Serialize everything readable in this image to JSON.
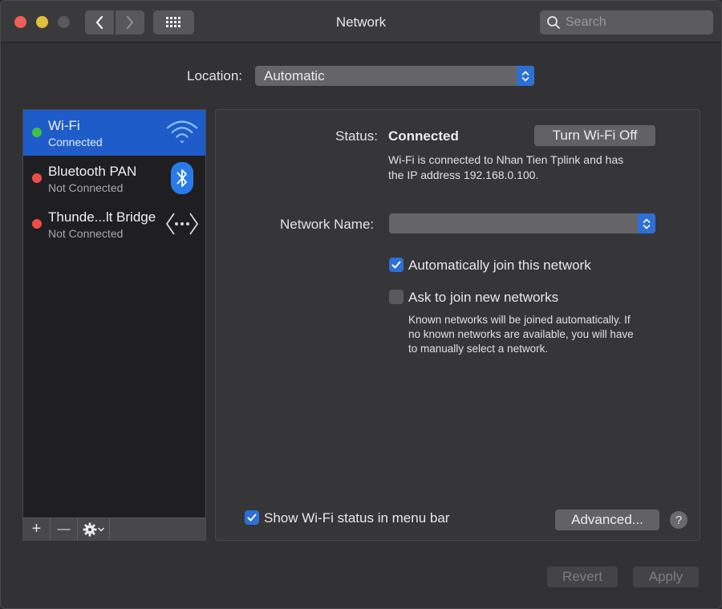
{
  "window": {
    "title": "Network",
    "search_placeholder": "Search"
  },
  "location": {
    "label": "Location:",
    "value": "Automatic"
  },
  "services": [
    {
      "name": "Wi-Fi",
      "status": "Connected",
      "status_color": "#3fc248",
      "icon": "wifi-icon",
      "selected": true
    },
    {
      "name": "Bluetooth PAN",
      "status": "Not Connected",
      "status_color": "#ef4b4b",
      "icon": "bluetooth-icon",
      "selected": false
    },
    {
      "name": "Thunde...lt Bridge",
      "status": "Not Connected",
      "status_color": "#ef4b4b",
      "icon": "thunderbolt-bridge-icon",
      "selected": false
    }
  ],
  "sidebar_toolbar": {
    "add": "+",
    "remove": "—"
  },
  "detail": {
    "status_label": "Status:",
    "status_value": "Connected",
    "turn_off_button": "Turn Wi-Fi Off",
    "status_description_1": "Wi-Fi is connected to Nhan Tien Tplink and has",
    "status_description_2": "the IP address 192.168.0.100.",
    "network_name_label": "Network Name:",
    "network_name_value": "",
    "auto_join_label": "Automatically join this network",
    "auto_join_checked": true,
    "ask_join_label": "Ask to join new networks",
    "ask_join_checked": false,
    "ask_join_help_1": "Known networks will be joined automatically. If",
    "ask_join_help_2": "no known networks are available, you will have",
    "ask_join_help_3": "to manually select a network.",
    "show_status_label": "Show Wi-Fi status in menu bar",
    "show_status_checked": true,
    "advanced_button": "Advanced...",
    "help_button": "?"
  },
  "footer": {
    "revert_button": "Revert",
    "apply_button": "Apply"
  },
  "colors": {
    "accent": "#2d6fd6",
    "selected_row": "#1d5cc9"
  }
}
